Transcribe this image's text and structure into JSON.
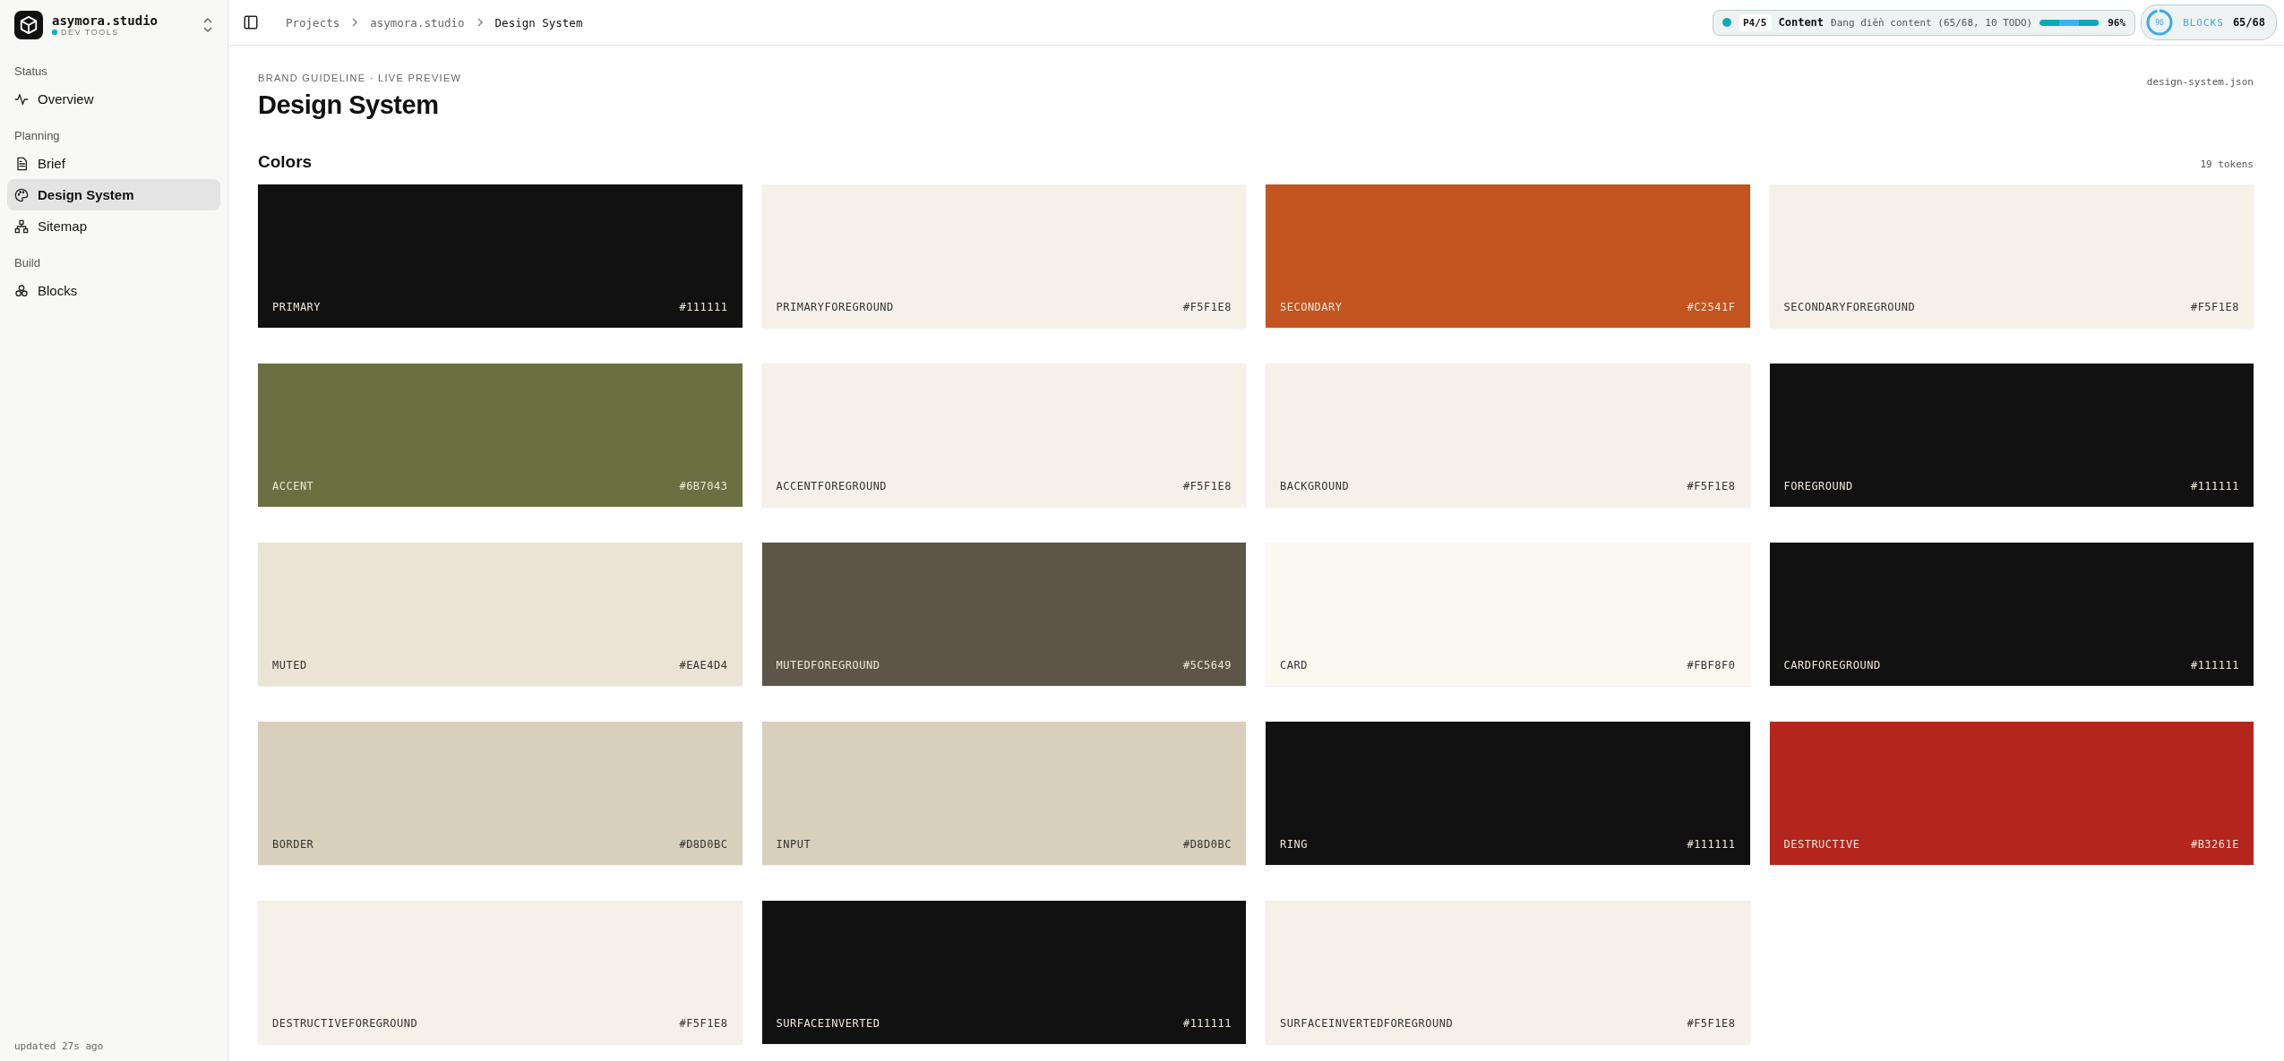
{
  "workspace": {
    "name": "asymora.studio",
    "subtitle": "DEV TOOLS"
  },
  "sidebar": {
    "sections": [
      {
        "title": "Status",
        "items": [
          {
            "label": "Overview",
            "selected": false
          }
        ]
      },
      {
        "title": "Planning",
        "items": [
          {
            "label": "Brief",
            "selected": false
          },
          {
            "label": "Design System",
            "selected": true
          },
          {
            "label": "Sitemap",
            "selected": false
          }
        ]
      },
      {
        "title": "Build",
        "items": [
          {
            "label": "Blocks",
            "selected": false
          }
        ]
      }
    ],
    "footer": "updated 27s ago"
  },
  "breadcrumb": [
    "Projects",
    "asymora.studio",
    "Design System"
  ],
  "phase": {
    "step": "P4/5",
    "title": "Content",
    "detail": "Đang điền content (65/68, 10 TODO)",
    "level": 0.96,
    "percent": "96%"
  },
  "blocks": {
    "ring_label": "96",
    "level": 0.96,
    "label": "BLOCKS",
    "count": "65/68"
  },
  "page": {
    "eyebrow": "BRAND GUIDELINE · LIVE PREVIEW",
    "title": "Design System",
    "file": "design-system.json"
  },
  "colors": {
    "title": "Colors",
    "count": "19 tokens",
    "tokens": [
      {
        "name": "PRIMARY",
        "hex": "#111111",
        "color": "#111111"
      },
      {
        "name": "PRIMARYFOREGROUND",
        "hex": "#F5F1E8",
        "color": "#f5f1e8"
      },
      {
        "name": "SECONDARY",
        "hex": "#C2541F",
        "color": "#c2541f"
      },
      {
        "name": "SECONDARYFOREGROUND",
        "hex": "#F5F1E8",
        "color": "#f5f1e8"
      },
      {
        "name": "ACCENT",
        "hex": "#6B7043",
        "color": "#6b7043"
      },
      {
        "name": "ACCENTFOREGROUND",
        "hex": "#F5F1E8",
        "color": "#f5f1e8"
      },
      {
        "name": "BACKGROUND",
        "hex": "#F5F1E8",
        "color": "#f5f1e8"
      },
      {
        "name": "FOREGROUND",
        "hex": "#111111",
        "color": "#111111"
      },
      {
        "name": "MUTED",
        "hex": "#EAE4D4",
        "color": "#eae4d4"
      },
      {
        "name": "MUTEDFOREGROUND",
        "hex": "#5C5649",
        "color": "#5c5649"
      },
      {
        "name": "CARD",
        "hex": "#FBF8F0",
        "color": "#fbf8f0"
      },
      {
        "name": "CARDFOREGROUND",
        "hex": "#111111",
        "color": "#111111"
      },
      {
        "name": "BORDER",
        "hex": "#D8D0BC",
        "color": "#d8d0bc"
      },
      {
        "name": "INPUT",
        "hex": "#D8D0BC",
        "color": "#d8d0bc"
      },
      {
        "name": "RING",
        "hex": "#111111",
        "color": "#111111"
      },
      {
        "name": "DESTRUCTIVE",
        "hex": "#B3261E",
        "color": "#b3261e"
      },
      {
        "name": "DESTRUCTIVEFOREGROUND",
        "hex": "#F5F1E8",
        "color": "#f5f1e8"
      },
      {
        "name": "SURFACEINVERTED",
        "hex": "#111111",
        "color": "#111111"
      },
      {
        "name": "SURFACEINVERTEDFOREGROUND",
        "hex": "#F5F1E8",
        "color": "#f5f1e8"
      }
    ]
  }
}
